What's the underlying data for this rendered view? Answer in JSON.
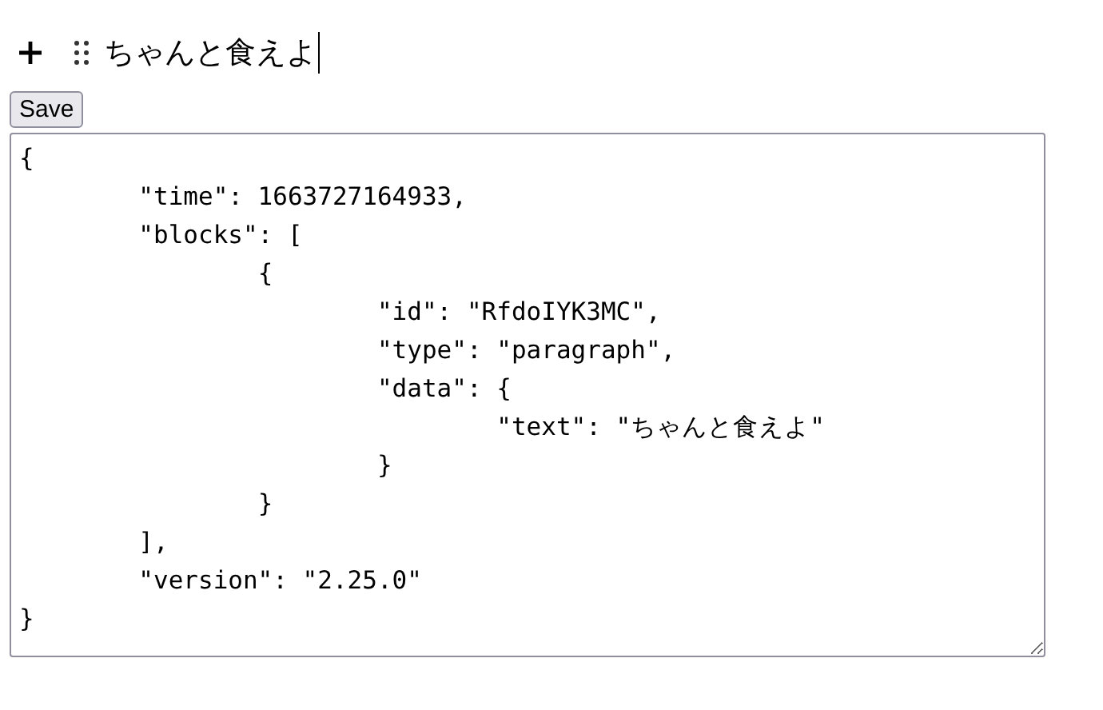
{
  "editor": {
    "block_text": "ちゃんと食えよ"
  },
  "save_button": {
    "label": "Save"
  },
  "output": {
    "value": "{\n\t\"time\": 1663727164933,\n\t\"blocks\": [\n\t\t{\n\t\t\t\"id\": \"RfdoIYK3MC\",\n\t\t\t\"type\": \"paragraph\",\n\t\t\t\"data\": {\n\t\t\t\t\"text\": \"ちゃんと食えよ\"\n\t\t\t}\n\t\t}\n\t],\n\t\"version\": \"2.25.0\"\n}"
  }
}
